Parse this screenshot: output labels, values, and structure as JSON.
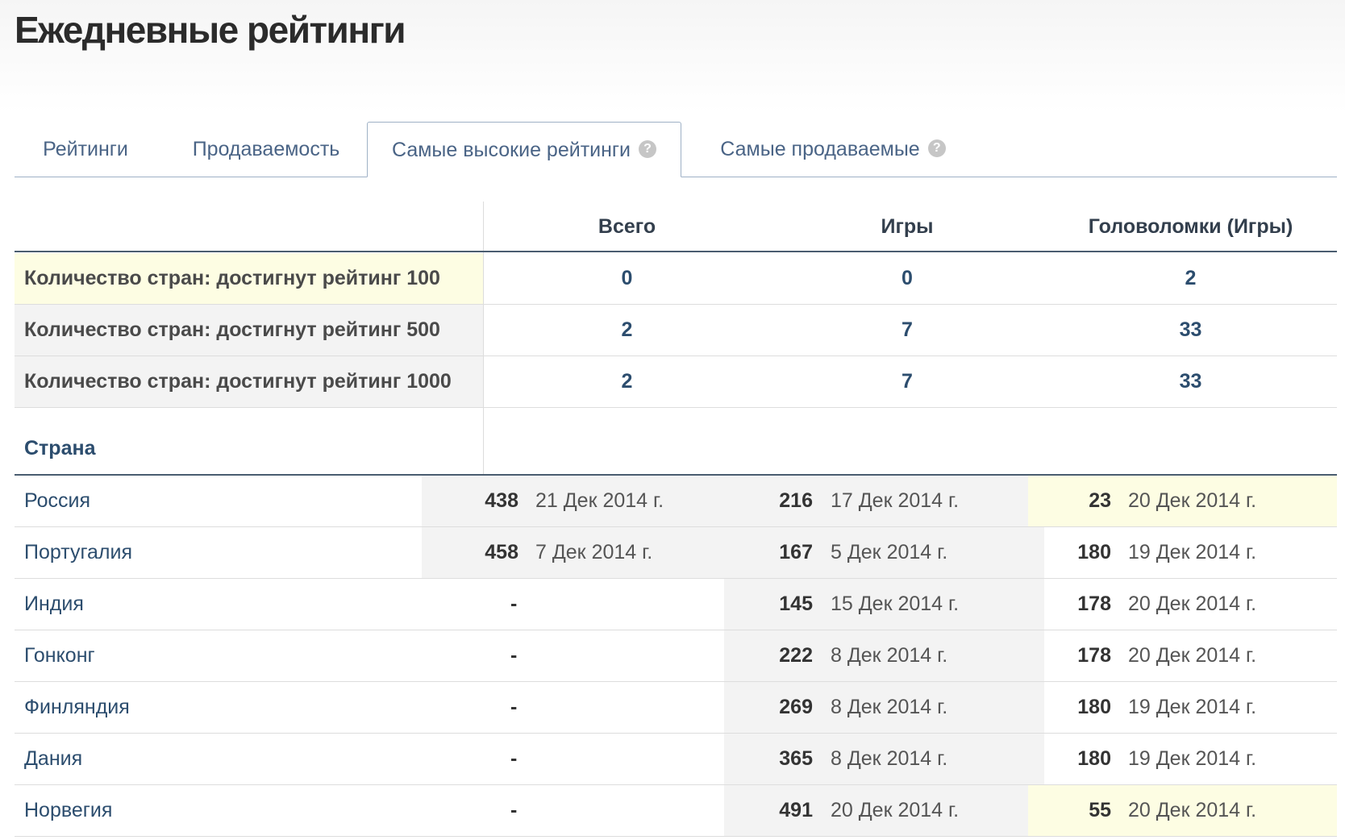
{
  "page_title": "Ежедневные рейтинги",
  "tabs": [
    {
      "label": "Рейтинги",
      "active": false,
      "help": false
    },
    {
      "label": "Продаваемость",
      "active": false,
      "help": false
    },
    {
      "label": "Самые высокие рейтинги",
      "active": true,
      "help": true
    },
    {
      "label": "Самые продаваемые",
      "active": false,
      "help": true
    }
  ],
  "help_glyph": "?",
  "columns": [
    "Всего",
    "Игры",
    "Головоломки (Игры)"
  ],
  "summary_rows": [
    {
      "label": "Количество стран: достигнут рейтинг 100",
      "values": [
        "0",
        "0",
        "2"
      ]
    },
    {
      "label": "Количество стран: достигнут рейтинг 500",
      "values": [
        "2",
        "7",
        "33"
      ]
    },
    {
      "label": "Количество стран: достигнут рейтинг 1000",
      "values": [
        "2",
        "7",
        "33"
      ]
    }
  ],
  "country_header": "Страна",
  "countries": [
    {
      "name": "Россия",
      "total": {
        "rank": "438",
        "date": "21 Дек 2014 г."
      },
      "games": {
        "rank": "216",
        "date": "17 Дек 2014 г."
      },
      "puzzles": {
        "rank": "23",
        "date": "20 Дек 2014 г."
      }
    },
    {
      "name": "Португалия",
      "total": {
        "rank": "458",
        "date": "7 Дек 2014 г."
      },
      "games": {
        "rank": "167",
        "date": "5 Дек 2014 г."
      },
      "puzzles": {
        "rank": "180",
        "date": "19 Дек 2014 г."
      }
    },
    {
      "name": "Индия",
      "total": {
        "rank": "-",
        "date": ""
      },
      "games": {
        "rank": "145",
        "date": "15 Дек 2014 г."
      },
      "puzzles": {
        "rank": "178",
        "date": "20 Дек 2014 г."
      }
    },
    {
      "name": "Гонконг",
      "total": {
        "rank": "-",
        "date": ""
      },
      "games": {
        "rank": "222",
        "date": "8 Дек 2014 г."
      },
      "puzzles": {
        "rank": "178",
        "date": "20 Дек 2014 г."
      }
    },
    {
      "name": "Финляндия",
      "total": {
        "rank": "-",
        "date": ""
      },
      "games": {
        "rank": "269",
        "date": "8 Дек 2014 г."
      },
      "puzzles": {
        "rank": "180",
        "date": "19 Дек 2014 г."
      }
    },
    {
      "name": "Дания",
      "total": {
        "rank": "-",
        "date": ""
      },
      "games": {
        "rank": "365",
        "date": "8 Дек 2014 г."
      },
      "puzzles": {
        "rank": "180",
        "date": "19 Дек 2014 г."
      }
    },
    {
      "name": "Норвегия",
      "total": {
        "rank": "-",
        "date": ""
      },
      "games": {
        "rank": "491",
        "date": "20 Дек 2014 г."
      },
      "puzzles": {
        "rank": "55",
        "date": "20 Дек 2014 г."
      }
    }
  ],
  "colors": {
    "highlight": "#fdfde3",
    "shade": "#f3f3f3",
    "link": "#2c4d6e",
    "tab_text": "#4a6486"
  }
}
